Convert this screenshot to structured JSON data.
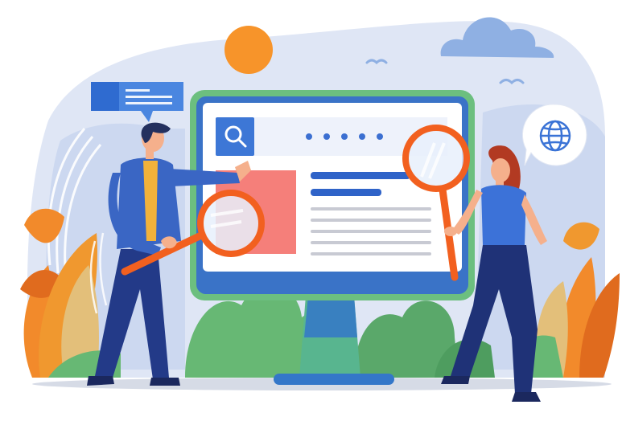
{
  "palette": {
    "blob": "#dfe6f5",
    "blob_stroke": "#c9d4ee",
    "sky_card": "#b8c8ea",
    "cloud": "#8fb0e3",
    "sun": "#f7942a",
    "monitor_frame": "#3a73c7",
    "monitor_green": "#6cbf7f",
    "screen": "#ffffff",
    "search_box": "#3d77d6",
    "dots": "#3b6fd1",
    "image_placeholder": "#f57f7a",
    "text_line_dark": "#2f63c8",
    "text_line_light": "#c8cad3",
    "stand_green": "#58b58f",
    "stand_blue": "#3477c9",
    "ground_shadow": "#d6dbe6",
    "leaf_orange": "#f28a2b",
    "leaf_dark_orange": "#e06b1e",
    "leaf_tan": "#e3bf7a",
    "shrub_green": "#67b874",
    "shrub_dark_green": "#4e9d5f",
    "man_jacket": "#3a66c4",
    "man_shirt": "#f2b23b",
    "man_pants": "#233a88",
    "skin": "#f5b08c",
    "hair": "#24305e",
    "woman_top": "#3c72d8",
    "woman_pants": "#1f3277",
    "woman_hair": "#b23a22",
    "magnifier_ring": "#f2601f",
    "lens_glass": "#e7f0fb",
    "chat_blue": "#2f6bd0",
    "globe_blue": "#3a73d6",
    "bird": "#8fb0e3"
  },
  "icons": {
    "search": "search-icon",
    "globe": "globe-icon",
    "chat": "chat-bubble-icon"
  }
}
